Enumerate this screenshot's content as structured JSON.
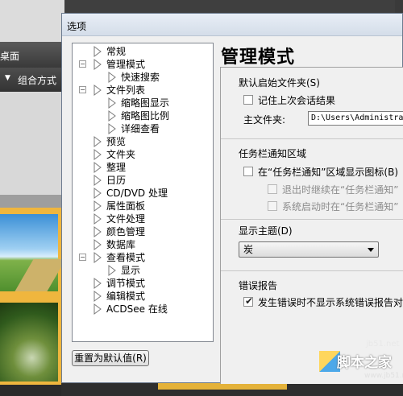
{
  "background_app": {
    "menu_label": "桌面",
    "sort_label": "组合方式"
  },
  "dialog": {
    "title": "选项",
    "tree": [
      {
        "label": "常规",
        "level": 0,
        "expander": ""
      },
      {
        "label": "管理模式",
        "level": 0,
        "expander": "−"
      },
      {
        "label": "快速搜索",
        "level": 1,
        "expander": ""
      },
      {
        "label": "文件列表",
        "level": 0,
        "expander": "−"
      },
      {
        "label": "缩略图显示",
        "level": 1,
        "expander": ""
      },
      {
        "label": "缩略图比例",
        "level": 1,
        "expander": ""
      },
      {
        "label": "详细查看",
        "level": 1,
        "expander": ""
      },
      {
        "label": "预览",
        "level": 0,
        "expander": ""
      },
      {
        "label": "文件夹",
        "level": 0,
        "expander": ""
      },
      {
        "label": "整理",
        "level": 0,
        "expander": ""
      },
      {
        "label": "日历",
        "level": 0,
        "expander": ""
      },
      {
        "label": "CD/DVD 处理",
        "level": 0,
        "expander": ""
      },
      {
        "label": "属性面板",
        "level": 0,
        "expander": ""
      },
      {
        "label": "文件处理",
        "level": 0,
        "expander": ""
      },
      {
        "label": "颜色管理",
        "level": 0,
        "expander": ""
      },
      {
        "label": "数据库",
        "level": 0,
        "expander": ""
      },
      {
        "label": "查看模式",
        "level": 0,
        "expander": "−"
      },
      {
        "label": "显示",
        "level": 1,
        "expander": ""
      },
      {
        "label": "调节模式",
        "level": 0,
        "expander": ""
      },
      {
        "label": "编辑模式",
        "level": 0,
        "expander": ""
      },
      {
        "label": "ACDSee 在线",
        "level": 0,
        "expander": ""
      }
    ],
    "reset_label": "重置为默认值(R)",
    "panel_heading": "管理模式",
    "startup": {
      "title": "默认启始文件夹(S)",
      "remember_label": "记住上次会话结果",
      "remember_checked": false,
      "home_label": "主文件夹:",
      "home_value": "D:\\Users\\Administrator\\Pictures"
    },
    "tray": {
      "title": "任务栏通知区域",
      "show_icon_label": "在“任务栏通知”区域显示图标(B)",
      "show_icon_checked": false,
      "keep_on_exit_label": "退出时继续在“任务栏通知”",
      "start_on_boot_label": "系统启动时在“任务栏通知”"
    },
    "theme": {
      "title": "显示主题(D)",
      "value": "炭"
    },
    "errors": {
      "title": "错误报告",
      "no_dialog_label": "发生错误时不显示系统错误报告对话框",
      "no_dialog_checked": true
    }
  },
  "watermark": {
    "site": "jb51.net",
    "brand": "脚本之家",
    "url": "www.jb51.net"
  }
}
